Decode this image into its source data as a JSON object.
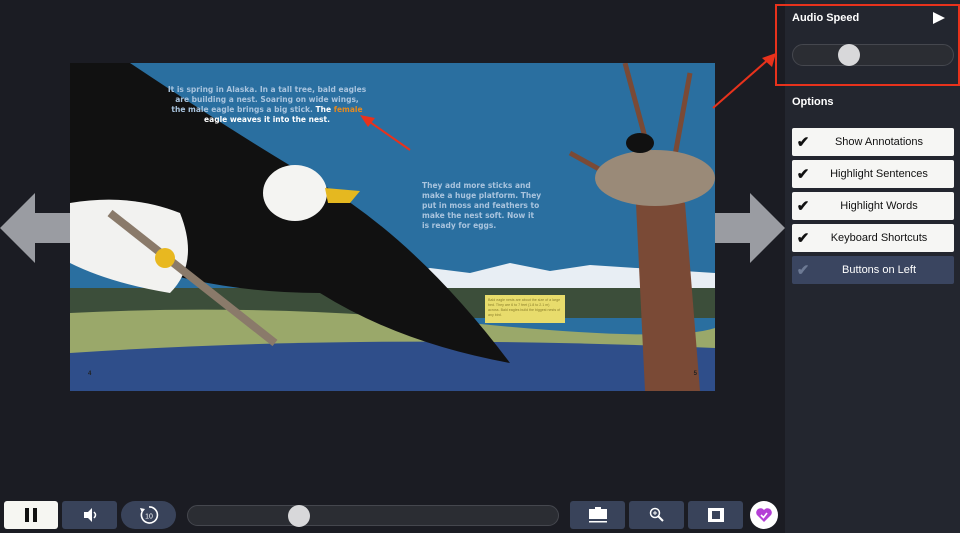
{
  "book": {
    "left_text_plain": "It is spring in Alaska. In a tall tree, bald eagles are building a nest. Soaring on wide wings, the male eagle brings a big stick.",
    "left_text_white_1": "The",
    "left_text_orange": "female",
    "left_text_white_2": "eagle weaves it into the nest.",
    "right_text": "They add more sticks and make a huge platform. They put in moss and feathers to make the nest soft. Now it is ready for eggs.",
    "note_text": "Bald eagle nests are about the size of a large bed. They are 6 to 7 feet (1.8 to 2.1 m) across. Bald eagles build the biggest nests of any bird.",
    "page_left": "4",
    "page_right": "5"
  },
  "sidebar": {
    "audio_speed_label": "Audio Speed",
    "audio_speed_value": 0.35,
    "options_label": "Options",
    "options": [
      {
        "label": "Show Annotations",
        "checked": true
      },
      {
        "label": "Highlight Sentences",
        "checked": true
      },
      {
        "label": "Highlight Words",
        "checked": true
      },
      {
        "label": "Keyboard Shortcuts",
        "checked": true
      },
      {
        "label": "Buttons on Left",
        "checked": false
      }
    ]
  },
  "toolbar": {
    "progress": 0.3,
    "replay_seconds": "10"
  },
  "colors": {
    "annotation": "#e8321c",
    "accent_button": "#39435a",
    "heart": "#b43fd6"
  }
}
